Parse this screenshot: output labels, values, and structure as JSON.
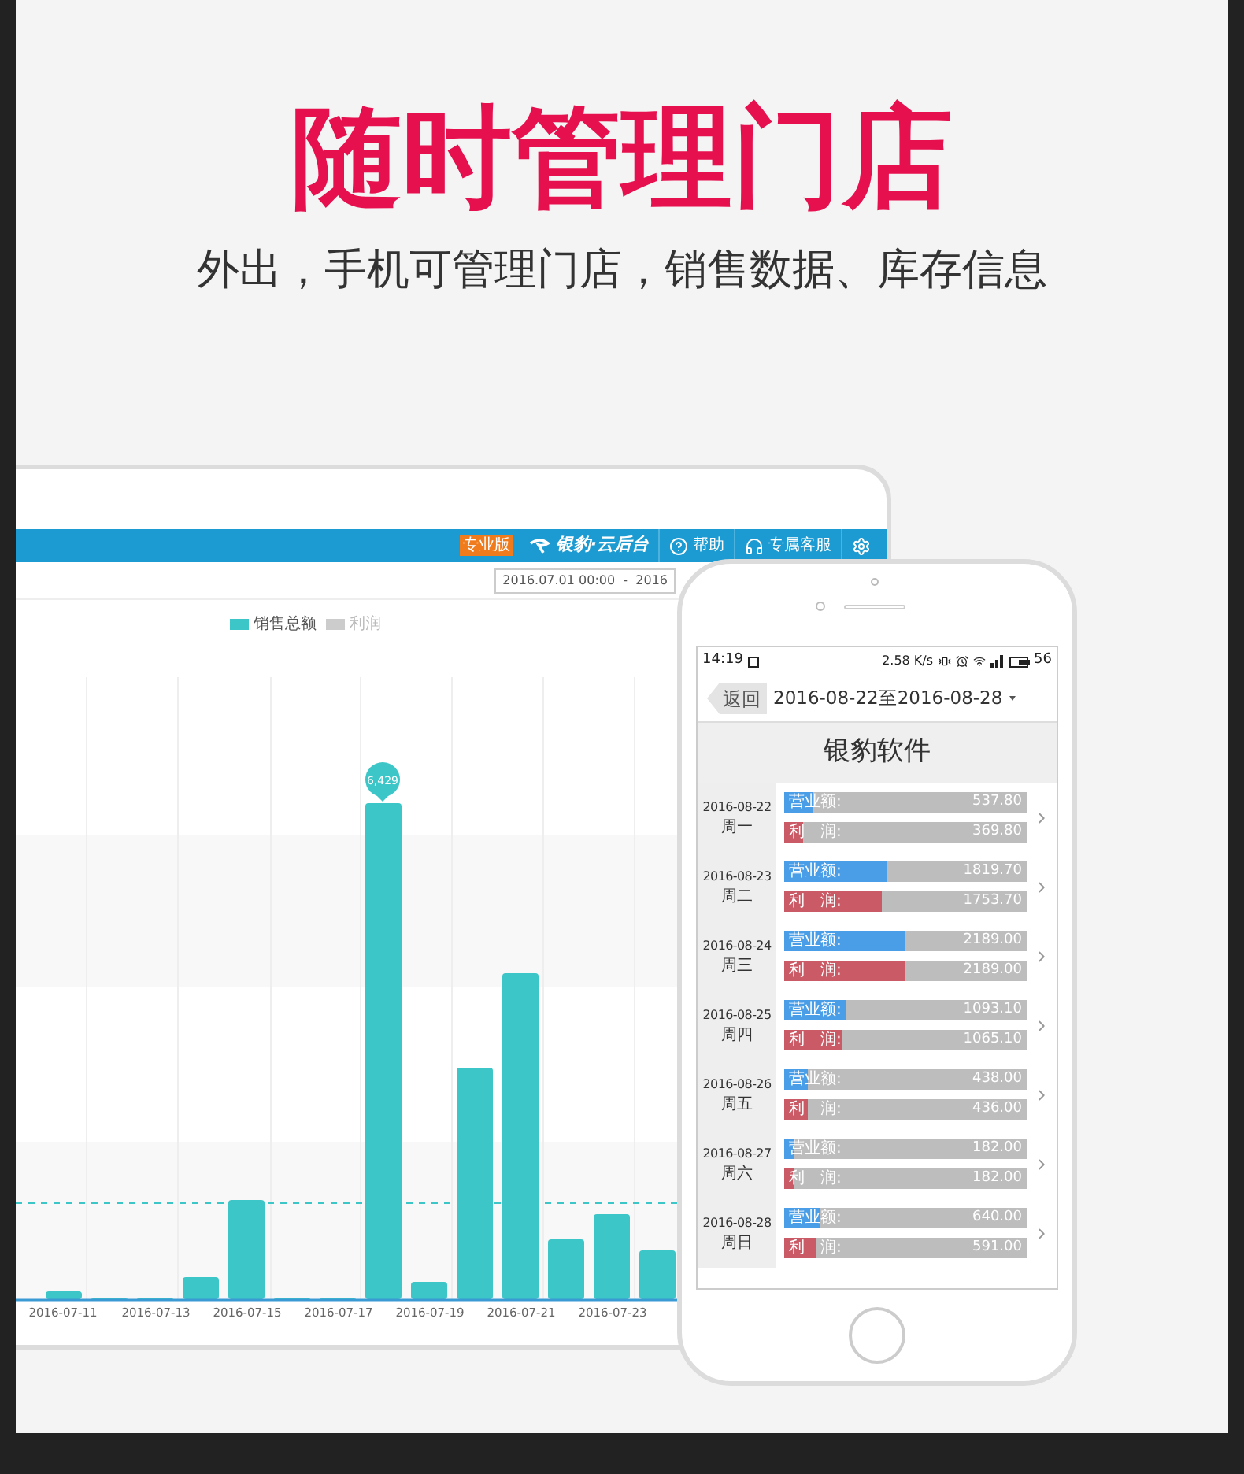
{
  "headline": "随时管理门店",
  "subheadline": "外出，手机可管理门店，销售数据、库存信息",
  "web_dashboard": {
    "edition_badge": "专业版",
    "brand": "银豹·云后台",
    "nav": [
      {
        "kind": "help",
        "label": "帮助"
      },
      {
        "kind": "service",
        "label": "专属客服"
      },
      {
        "kind": "settings"
      }
    ],
    "date_range": "2016.07.01 00:00  -  2016",
    "legend": [
      {
        "label": "销售总额",
        "color": "#3cc6c8"
      },
      {
        "label": "利润",
        "color": "#cccccc"
      }
    ],
    "peak_label": "6,429",
    "x_labels": [
      "2016-07-11",
      "2016-07-13",
      "2016-07-15",
      "2016-07-17",
      "2016-07-19",
      "2016-07-21",
      "2016-07-23"
    ]
  },
  "phone": {
    "status_bar": {
      "time": "14:19",
      "speed": "2.58 K/s",
      "battery": "56"
    },
    "back_button": "返回",
    "date_range": "2016-08-22至2016-08-28",
    "store_name": "银豹软件",
    "days": [
      {
        "date": "2016-08-22",
        "weekday": "周一",
        "metrics": [
          {
            "label": "营业额:",
            "value": "537.80",
            "level": 0.12,
            "color": "#4a9ee8"
          },
          {
            "label": "利　润:",
            "value": "369.80",
            "level": 0.08,
            "color": "#c95a66"
          }
        ]
      },
      {
        "date": "2016-08-23",
        "weekday": "周二",
        "metrics": [
          {
            "label": "营业额:",
            "value": "1819.70",
            "level": 0.42,
            "color": "#4a9ee8"
          },
          {
            "label": "利　润:",
            "value": "1753.70",
            "level": 0.4,
            "color": "#c95a66"
          }
        ]
      },
      {
        "date": "2016-08-24",
        "weekday": "周三",
        "metrics": [
          {
            "label": "营业额:",
            "value": "2189.00",
            "level": 0.5,
            "color": "#4a9ee8"
          },
          {
            "label": "利　润:",
            "value": "2189.00",
            "level": 0.5,
            "color": "#c95a66"
          }
        ]
      },
      {
        "date": "2016-08-25",
        "weekday": "周四",
        "metrics": [
          {
            "label": "营业额:",
            "value": "1093.10",
            "level": 0.25,
            "color": "#4a9ee8"
          },
          {
            "label": "利　润:",
            "value": "1065.10",
            "level": 0.24,
            "color": "#c95a66"
          }
        ]
      },
      {
        "date": "2016-08-26",
        "weekday": "周五",
        "metrics": [
          {
            "label": "营业额:",
            "value": "438.00",
            "level": 0.1,
            "color": "#4a9ee8"
          },
          {
            "label": "利　润:",
            "value": "436.00",
            "level": 0.1,
            "color": "#c95a66"
          }
        ]
      },
      {
        "date": "2016-08-27",
        "weekday": "周六",
        "metrics": [
          {
            "label": "营业额:",
            "value": "182.00",
            "level": 0.04,
            "color": "#4a9ee8"
          },
          {
            "label": "利　润:",
            "value": "182.00",
            "level": 0.04,
            "color": "#c95a66"
          }
        ]
      },
      {
        "date": "2016-08-28",
        "weekday": "周日",
        "metrics": [
          {
            "label": "营业额:",
            "value": "640.00",
            "level": 0.15,
            "color": "#4a9ee8"
          },
          {
            "label": "利　润:",
            "value": "591.00",
            "level": 0.13,
            "color": "#c95a66"
          }
        ]
      }
    ]
  }
}
